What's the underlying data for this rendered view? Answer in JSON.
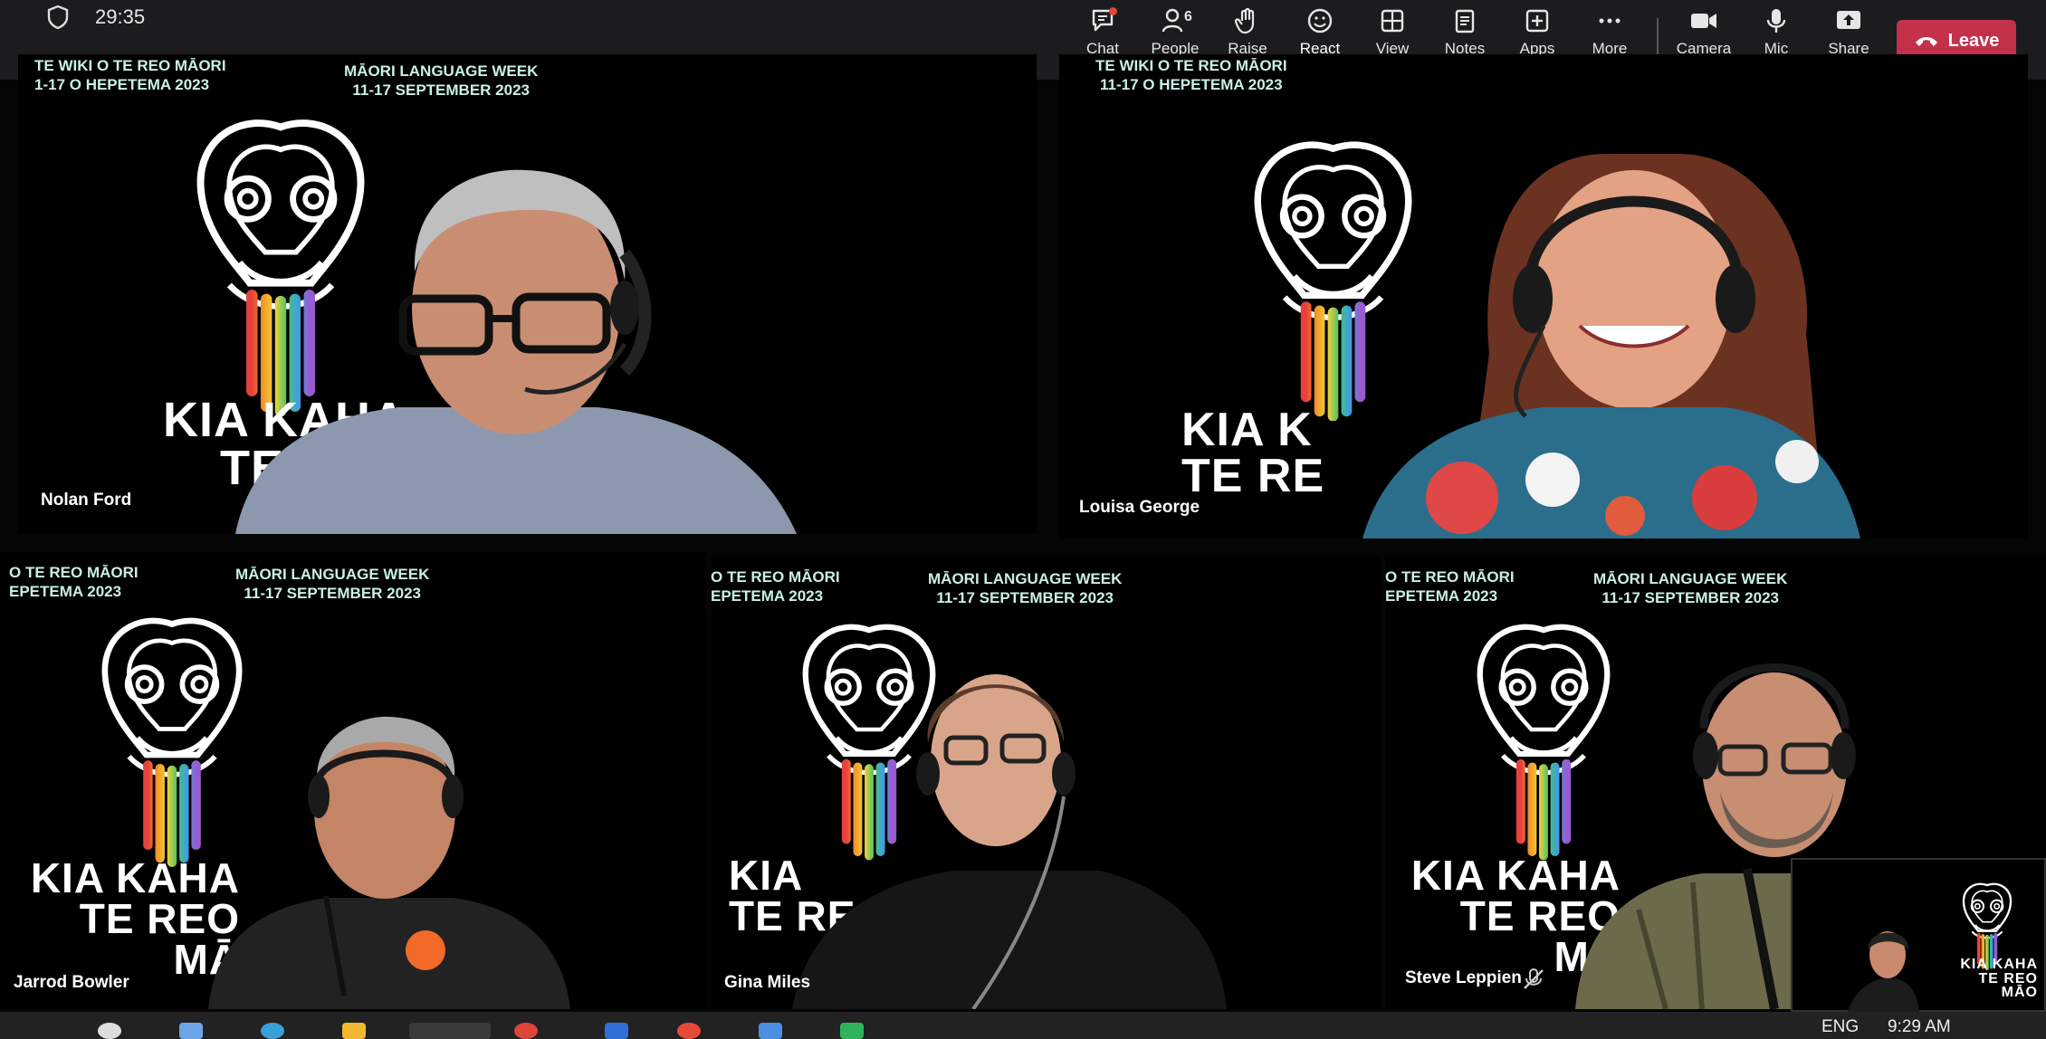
{
  "meeting": {
    "timer": "29:35"
  },
  "toolbar": {
    "chat": "Chat",
    "people": "People",
    "people_count": "6",
    "raise": "Raise",
    "react": "React",
    "view": "View",
    "notes": "Notes",
    "apps": "Apps",
    "more": "More",
    "camera": "Camera",
    "mic": "Mic",
    "share": "Share",
    "leave": "Leave"
  },
  "reactions": [
    "👍",
    "❤️",
    "👏",
    "😆",
    "😮"
  ],
  "tiles": [
    {
      "name": "Nolan Ford",
      "banner_left_1": "TE WIKI O TE REO MĀORI",
      "banner_left_2": "1-17 O HEPETEMA 2023",
      "banner_right_1": "MĀORI LANGUAGE WEEK",
      "banner_right_2": "11-17 SEPTEMBER 2023",
      "kia_1": "KIA KAHA",
      "kia_2": "TE REO"
    },
    {
      "name": "Louisa George",
      "banner_left_1": "TE WIKI O TE REO MĀORI",
      "banner_left_2": "11-17 O HEPETEMA 2023",
      "kia_1": "KIA K",
      "kia_2": "TE RE"
    },
    {
      "name": "Jarrod Bowler",
      "banner_left_1": "O TE REO MĀORI",
      "banner_left_2": "EPETEMA 2023",
      "banner_right_1": "MĀORI LANGUAGE WEEK",
      "banner_right_2": "11-17 SEPTEMBER 2023",
      "kia_1": "KIA KAHA",
      "kia_2": "TE REO MĀ"
    },
    {
      "name": "Gina Miles",
      "banner_left_1": "O TE REO MĀORI",
      "banner_left_2": "EPETEMA 2023",
      "banner_right_1": "MĀORI LANGUAGE WEEK",
      "banner_right_2": "11-17 SEPTEMBER 2023",
      "kia_1": "KIA",
      "kia_2": "TE RE"
    },
    {
      "name": "Steve Leppien",
      "banner_left_1": "O TE REO MĀORI",
      "banner_left_2": "EPETEMA 2023",
      "banner_right_1": "MĀORI LANGUAGE WEEK",
      "banner_right_2": "11-17 SEPTEMBER 2023",
      "kia_1": "KIA KAHA",
      "kia_2": "TE REO MA"
    }
  ],
  "selfview": {
    "kia_1": "KIA KAHA",
    "kia_2": "TE REO MĀO"
  },
  "system_tray": {
    "lang": "ENG",
    "time": "9:29 AM"
  },
  "colors": {
    "leave": "#c4314b",
    "accent": "#7f85f5",
    "banner_text": "#c9f0e6"
  }
}
